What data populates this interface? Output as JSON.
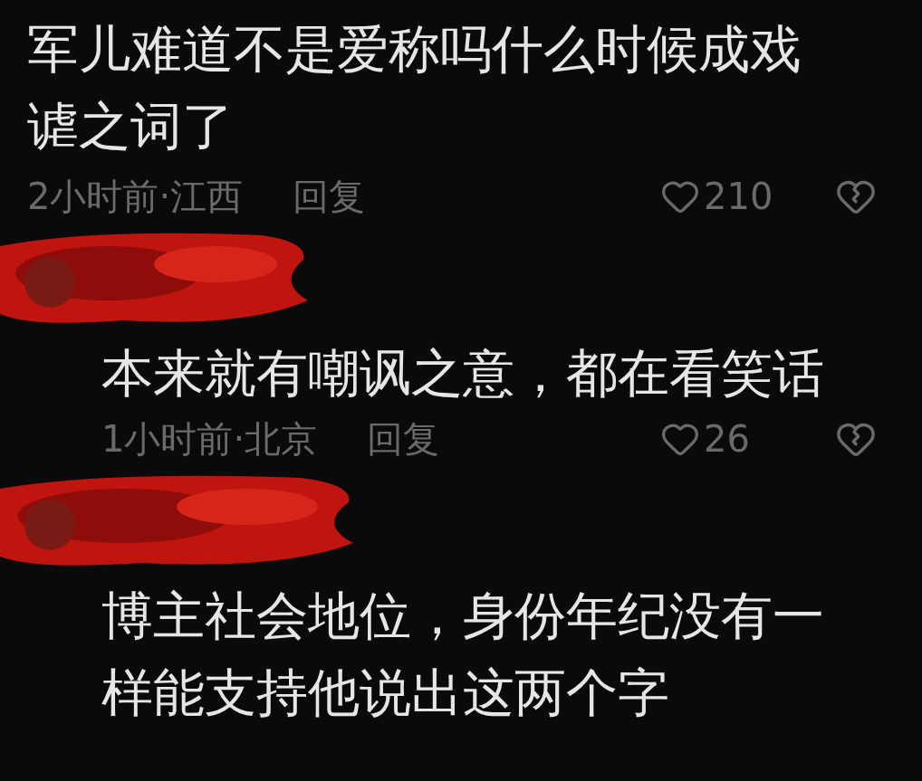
{
  "comment": {
    "text": "军儿难道不是爱称吗什么时候成戏谑之词了",
    "time_location": "2小时前·江西",
    "reply": "回复",
    "likes": "210"
  },
  "replies": [
    {
      "author_redacted": true,
      "text": "本来就有嘲讽之意，都在看笑话",
      "time_location": "1小时前·北京",
      "reply": "回复",
      "likes": "26"
    },
    {
      "author_redacted": true,
      "text": "博主社会地位，身份年纪没有一样能支持他说出这两个字"
    }
  ]
}
